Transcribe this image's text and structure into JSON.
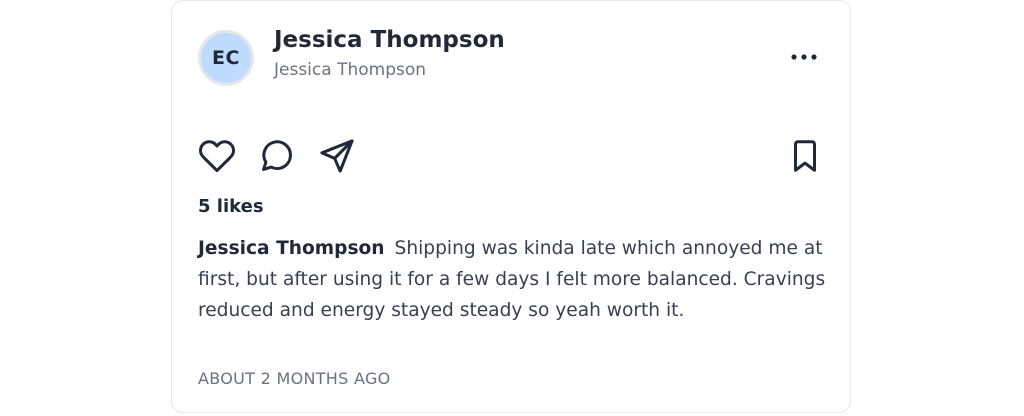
{
  "post": {
    "avatar_initials": "EC",
    "display_name": "Jessica Thompson",
    "username": "Jessica Thompson",
    "likes_text": "5 likes",
    "caption_author": "Jessica Thompson",
    "caption_text": "Shipping was kinda late which annoyed me at first, but after using it for a few days I felt more balanced. Cravings reduced and energy stayed steady so yeah worth it.",
    "timestamp": "ABOUT 2 MONTHS AGO"
  },
  "icons": {
    "more": "more-horizontal-icon",
    "like": "heart-icon",
    "comment": "comment-icon",
    "share": "send-icon",
    "save": "bookmark-icon"
  },
  "colors": {
    "avatar_bg": "#bfdbfe",
    "text_primary": "#1f2937",
    "text_secondary": "#6b7280",
    "border": "#e5e7eb"
  }
}
